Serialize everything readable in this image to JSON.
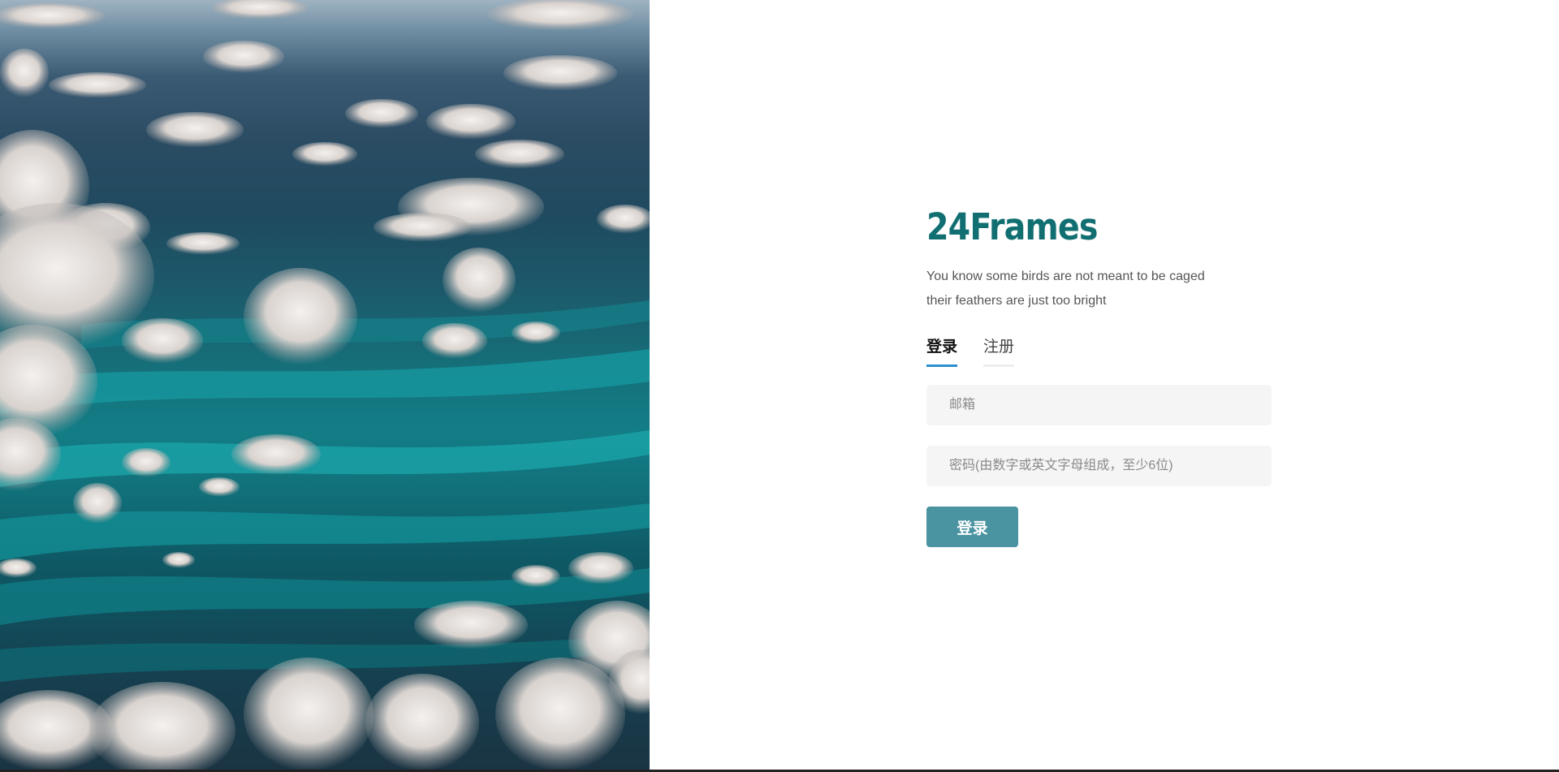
{
  "brand": {
    "title": "24Frames",
    "tagline_line1": "You know some birds are not meant to be caged",
    "tagline_line2": "their feathers are just too bright"
  },
  "tabs": [
    {
      "label": "登录",
      "active": true
    },
    {
      "label": "注册",
      "active": false
    }
  ],
  "form": {
    "email_placeholder": "邮箱",
    "email_value": "",
    "password_placeholder": "密码(由数字或英文字母组成，至少6位)",
    "password_value": "",
    "submit_label": "登录"
  },
  "hero": {
    "image_description_icon": "aerial-ocean-clouds-photo"
  },
  "colors": {
    "brand": "#116f72",
    "tab_active_underline": "#2a8fd0",
    "button_bg": "#4a93a1",
    "input_bg": "#f5f5f5"
  }
}
